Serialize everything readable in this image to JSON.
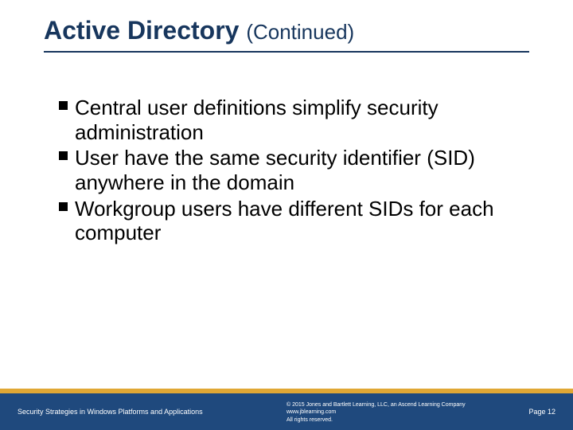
{
  "title": {
    "main": "Active Directory ",
    "sub": "(Continued)"
  },
  "bullets": [
    "Central user definitions simplify security administration",
    "User have the same security identifier (SID) anywhere in the domain",
    "Workgroup users have different SIDs for each computer"
  ],
  "footer": {
    "left": "Security Strategies in Windows Platforms and Applications",
    "copyright": "© 2015 Jones and Bartlett Learning, LLC, an Ascend Learning Company",
    "url": "www.jblearning.com",
    "rights": "All rights reserved.",
    "page": "Page 12"
  }
}
